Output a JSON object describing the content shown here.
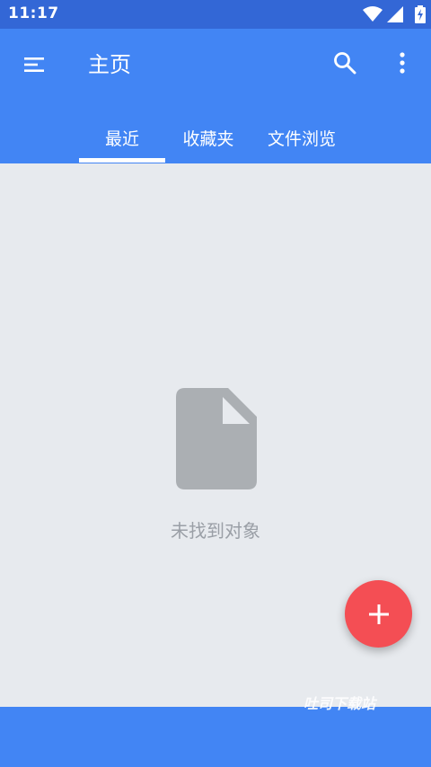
{
  "status_bar": {
    "time": "11:17",
    "icons": [
      "wifi-icon",
      "signal-icon",
      "battery-charging-icon"
    ]
  },
  "app_bar": {
    "title": "主页",
    "menu_icon": "menu-icon",
    "search_icon": "search-icon",
    "more_icon": "more-vert-icon",
    "color": "#4285f4"
  },
  "tabs": [
    {
      "label": "最近",
      "selected": true
    },
    {
      "label": "收藏夹",
      "selected": false
    },
    {
      "label": "文件浏览",
      "selected": false
    }
  ],
  "empty_state": {
    "icon": "file-icon",
    "message": "未找到对象"
  },
  "fab": {
    "icon": "add-icon",
    "color": "#f44e54"
  },
  "watermark": "吐司下载站"
}
